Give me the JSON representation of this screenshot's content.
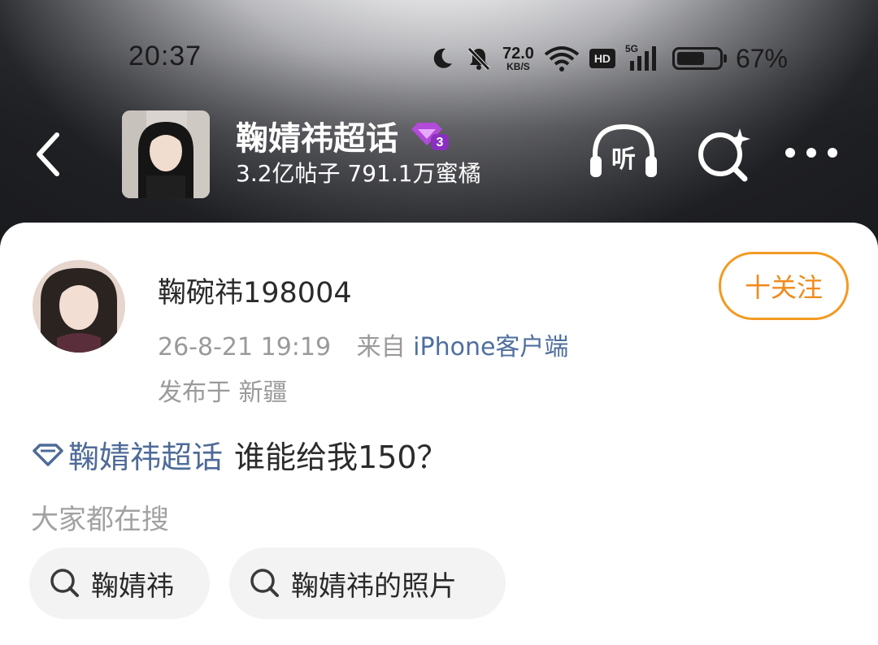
{
  "status_bar": {
    "time": "20:37",
    "net_speed_value": "72.0",
    "net_speed_unit": "KB/S",
    "hd_label": "HD",
    "signal_label": "5G",
    "battery_level": 0.67,
    "battery_percent": "67%"
  },
  "header": {
    "topic_name": "鞠婧祎超话",
    "badge_level": "3",
    "stats": "3.2亿帖子 791.1万蜜橘",
    "listen_label": "听"
  },
  "post": {
    "username": "鞠碗祎198004",
    "follow_label": "十关注",
    "date": "26-8-21 19:19",
    "from_label": "来自",
    "client": "iPhone客户端",
    "location": "发布于 新疆",
    "topic_link": "鞠婧祎超话",
    "text": "谁能给我150？"
  },
  "search_suggestions": {
    "heading": "大家都在搜",
    "items": [
      {
        "label": "鞠婧祎"
      },
      {
        "label": "鞠婧祎的照片"
      }
    ]
  }
}
